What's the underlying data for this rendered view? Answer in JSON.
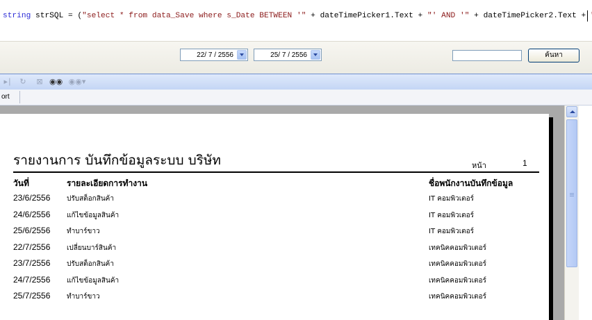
{
  "code": {
    "t1": "string",
    "t2": " strSQL = (",
    "t3": "\"select * from data_Save where s_Date BETWEEN '\"",
    "t4": " + dateTimePicker1.Text + ",
    "t5": "\"' AND '\"",
    "t6": " + dateTimePicker2.Text + ",
    "t7": "\"' \"",
    "t8": ");"
  },
  "search": {
    "date_from": "22/ 7 / 2556",
    "date_to": "25/ 7 / 2556",
    "input_value": "",
    "button_label": "ค้นหา"
  },
  "toolbar": {
    "export_tab_label": "ort"
  },
  "report": {
    "title": "รายงานการ บันทึกข้อมูลระบบ บริษัท",
    "page_label": "หน้า",
    "page_number": "1",
    "headers": {
      "date": "วันที่",
      "detail": "รายละเอียดการทำงาน",
      "employee": "ชื่อพนักงานบันทึกข้อมูล"
    },
    "rows": [
      {
        "date": "23/6/2556",
        "detail": "ปรับสต็อกสินค้า",
        "employee": "IT คอมพิวเตอร์"
      },
      {
        "date": "24/6/2556",
        "detail": "แก้ไขข้อมูลสินค้า",
        "employee": "IT คอมพิวเตอร์"
      },
      {
        "date": "25/6/2556",
        "detail": "ทำบาร์ขาว",
        "employee": "IT คอมพิวเตอร์"
      },
      {
        "date": "22/7/2556",
        "detail": "เปลี่ยนบาร์สินค้า",
        "employee": "เทคนิคคอมพิวเตอร์"
      },
      {
        "date": "23/7/2556",
        "detail": "ปรับสต็อกสินค้า",
        "employee": "เทคนิคคอมพิวเตอร์"
      },
      {
        "date": "24/7/2556",
        "detail": "แก้ไขข้อมูลสินค้า",
        "employee": "เทคนิคคอมพิวเตอร์"
      },
      {
        "date": "25/7/2556",
        "detail": "ทำบาร์ขาว",
        "employee": "เทคนิคคอมพิวเตอร์"
      }
    ]
  },
  "icons": {
    "next": "next-page-icon",
    "refresh": "refresh-icon",
    "stop": "stop-icon",
    "find": "binoculars-icon",
    "find_next": "find-next-icon"
  }
}
